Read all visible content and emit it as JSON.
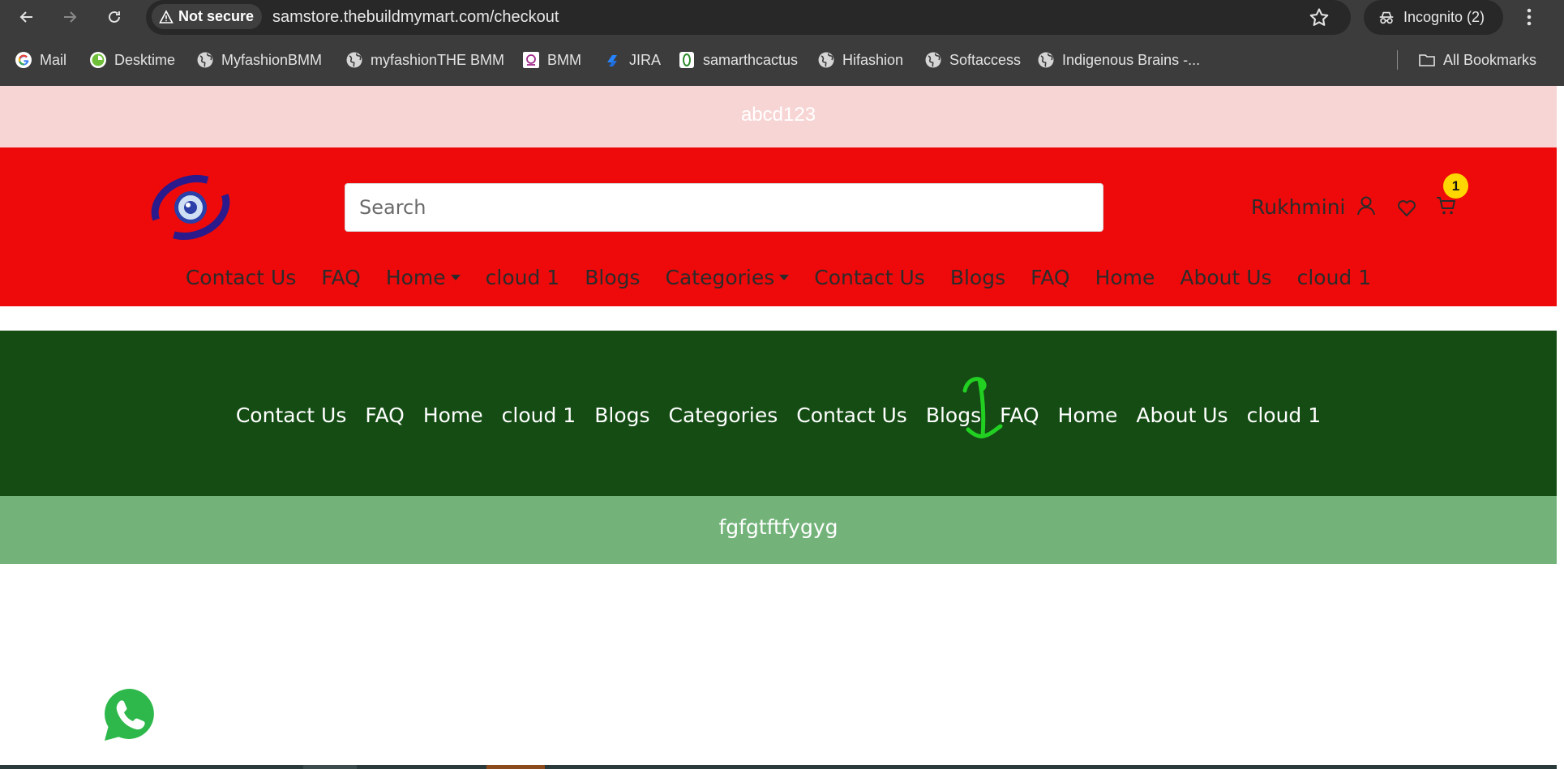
{
  "browser": {
    "security_label": "Not secure",
    "url": "samstore.thebuildmymart.com/checkout",
    "incognito_label": "Incognito (2)",
    "bookmarks": [
      {
        "label": "Mail",
        "icon": "google-icon"
      },
      {
        "label": "Desktime",
        "icon": "desktime-icon"
      },
      {
        "label": "MyfashionBMM",
        "icon": "globe-icon"
      },
      {
        "label": "myfashionTHE BMM",
        "icon": "globe-icon"
      },
      {
        "label": "BMM",
        "icon": "bmm-icon"
      },
      {
        "label": "JIRA",
        "icon": "jira-icon"
      },
      {
        "label": "samarthcactus",
        "icon": "cactus-icon"
      },
      {
        "label": "Hifashion",
        "icon": "globe-icon"
      },
      {
        "label": "Softaccess",
        "icon": "globe-icon"
      },
      {
        "label": "Indigenous Brains -...",
        "icon": "globe-icon"
      }
    ],
    "all_bookmarks_label": "All Bookmarks"
  },
  "announcement": {
    "text": "abcd123"
  },
  "header": {
    "search_placeholder": "Search",
    "user_name": "Rukhmini",
    "cart_count": "1",
    "nav": [
      {
        "label": "Contact Us",
        "dropdown": false
      },
      {
        "label": "FAQ",
        "dropdown": false
      },
      {
        "label": "Home",
        "dropdown": true
      },
      {
        "label": "cloud 1",
        "dropdown": false
      },
      {
        "label": "Blogs",
        "dropdown": false
      },
      {
        "label": "Categories",
        "dropdown": true
      },
      {
        "label": "Contact Us",
        "dropdown": false
      },
      {
        "label": "Blogs",
        "dropdown": false
      },
      {
        "label": "FAQ",
        "dropdown": false
      },
      {
        "label": "Home",
        "dropdown": false
      },
      {
        "label": "About Us",
        "dropdown": false
      },
      {
        "label": "cloud 1",
        "dropdown": false
      }
    ]
  },
  "secondary_nav": {
    "items": [
      "Contact Us",
      "FAQ",
      "Home",
      "cloud 1",
      "Blogs",
      "Categories",
      "Contact Us",
      "Blogs",
      "FAQ",
      "Home",
      "About Us",
      "cloud 1"
    ]
  },
  "banner": {
    "text": "fgfgtftfygyg"
  },
  "colors": {
    "announcement_bg": "#f7d5d4",
    "header_bg": "#ee0a0a",
    "secondary_nav_bg": "#144c14",
    "banner_bg": "#73b37a",
    "cart_badge": "#ffd600",
    "annotation_arrow": "#22d022"
  }
}
